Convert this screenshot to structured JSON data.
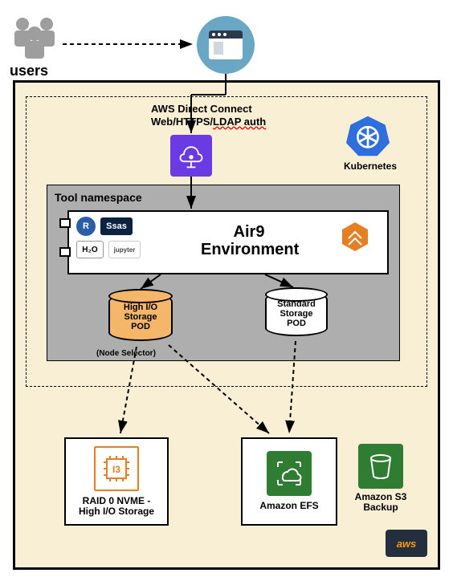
{
  "users": {
    "label": "users"
  },
  "connection": {
    "line1": "AWS  Direct Connect",
    "line2_prefix": "Web/HTTPS/",
    "line2_ldap": "LDAP auth"
  },
  "kubernetes": {
    "label": "Kubernetes"
  },
  "tool_namespace": {
    "title": "Tool namespace"
  },
  "air9": {
    "title_line1": "Air9",
    "title_line2": "Environment"
  },
  "tools": {
    "r": "R",
    "sas": "Ssas",
    "h2o": "H₂O",
    "jupyter": "jupyter"
  },
  "pods": {
    "high_io": "High I/O\nStorage\nPOD",
    "standard": "Standard\nStorage\nPOD",
    "node_selector": "(Node Selector)"
  },
  "services": {
    "raid": "RAID 0 NVME - High I/O Storage",
    "raid_chip": "I3",
    "efs": "Amazon EFS",
    "s3": "Amazon S3 Backup"
  },
  "aws_badge": "aws",
  "icons": {
    "users": "users-icon",
    "browser": "browser-window-icon",
    "gateway": "cloud-gateway-icon",
    "kubernetes": "kubernetes-wheel-icon",
    "orange_hex": "orange-hexagon-icon",
    "chip": "cpu-chip-icon",
    "efs": "efs-cloud-icon",
    "s3": "s3-bucket-icon"
  },
  "colors": {
    "beige": "#f8efd4",
    "purple": "#6a3be4",
    "k8s_blue": "#2f6ede",
    "pod_orange": "#f4b76a",
    "aws_green": "#2e7d32",
    "aws_orange": "#e67e22",
    "aws_dark": "#232f3e",
    "aws_gold": "#ff9900"
  }
}
